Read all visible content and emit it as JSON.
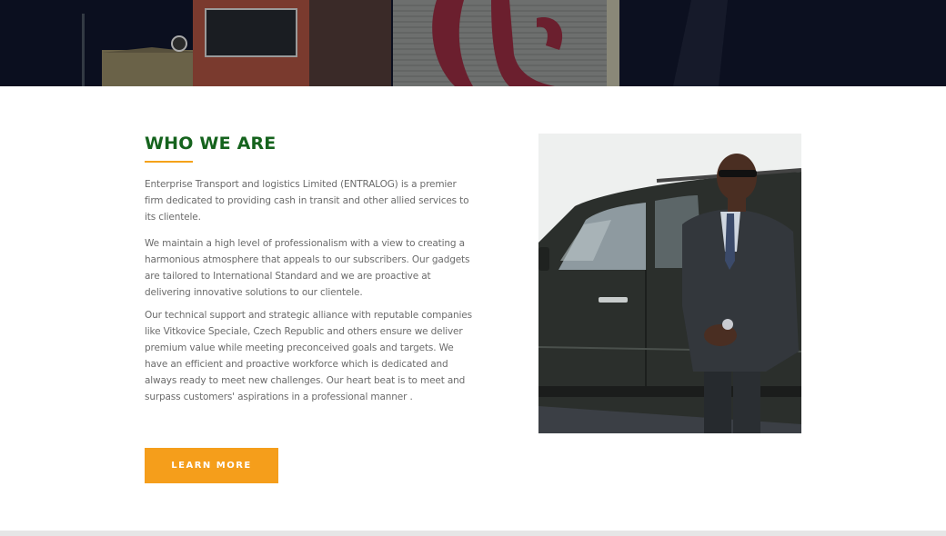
{
  "about": {
    "heading": "WHO WE ARE",
    "paragraphs": [
      "Enterprise Transport and logistics Limited (ENTRALOG) is a premier firm dedicated to providing cash in transit and other allied services to its clientele.",
      "We maintain a high level of professionalism with a view to creating a harmonious atmosphere that appeals to our subscribers. Our gadgets are tailored to International Standard and we are proactive at delivering innovative solutions to our clientele.",
      "Our technical support and strategic alliance with reputable companies like Vitkovice Speciale, Czech Republic and others ensure we deliver premium value while meeting preconceived goals and targets. We have an efficient and proactive workforce which is dedicated and always ready to meet new challenges. Our heart beat is to meet and surpass customers' aspirations in a professional manner ."
    ],
    "button_label": "LEARN MORE"
  },
  "colors": {
    "heading": "#15631d",
    "accent": "#f59e1b",
    "text": "#6b6b6b"
  }
}
